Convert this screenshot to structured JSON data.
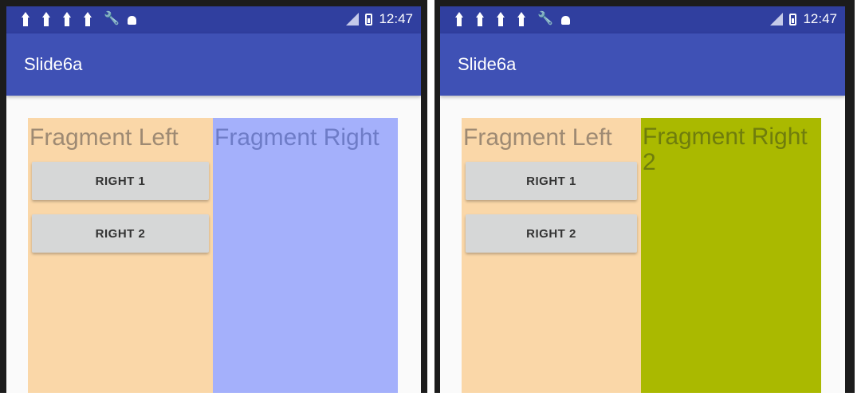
{
  "screens": [
    {
      "status": {
        "time": "12:47"
      },
      "app_title": "Slide6a",
      "left_fragment": {
        "title": "Fragment Left",
        "buttons": [
          "RIGHT 1",
          "RIGHT 2"
        ],
        "color": "#fad7a8"
      },
      "right_fragment": {
        "title": "Fragment Right",
        "color": "#a4b0fb"
      }
    },
    {
      "status": {
        "time": "12:47"
      },
      "app_title": "Slide6a",
      "left_fragment": {
        "title": "Fragment Left",
        "buttons": [
          "RIGHT 1",
          "RIGHT 2"
        ],
        "color": "#fad7a8"
      },
      "right_fragment": {
        "title": "Fragment Right 2",
        "color": "#aab900"
      }
    }
  ],
  "colors": {
    "status_bar": "#303f9f",
    "app_bar": "#3f51b5"
  },
  "icons": [
    "upload-icon",
    "upload-icon",
    "upload-icon",
    "upload-icon",
    "wrench-icon",
    "android-icon",
    "signal-icon",
    "battery-icon"
  ]
}
